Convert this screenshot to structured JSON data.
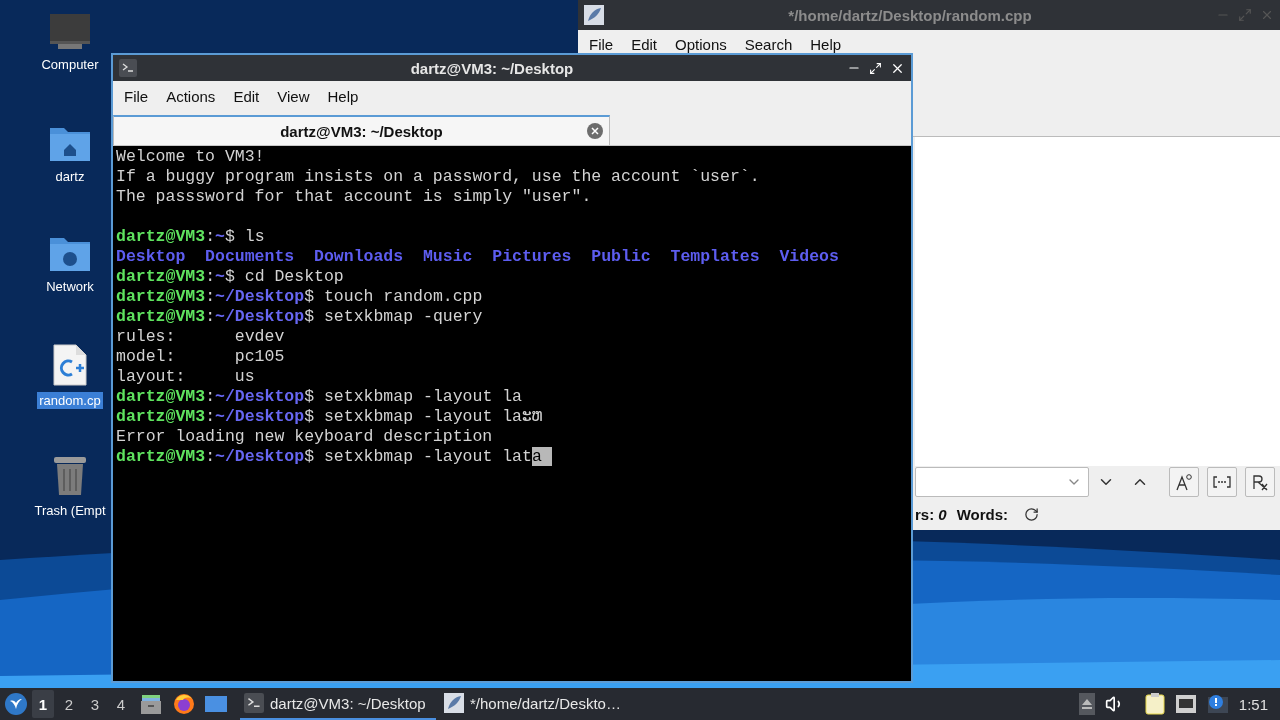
{
  "desktop_icons": [
    {
      "label": "Computer",
      "kind": "computer",
      "selected": false
    },
    {
      "label": "dartz",
      "kind": "home-folder",
      "selected": false
    },
    {
      "label": "Network",
      "kind": "network-folder",
      "selected": false
    },
    {
      "label": "random.cp",
      "kind": "cpp-file",
      "selected": true
    },
    {
      "label": "Trash (Empt",
      "kind": "trash",
      "selected": false
    }
  ],
  "editor_window": {
    "title": "*/home/dartz/Desktop/random.cpp",
    "active": false,
    "menu": [
      "File",
      "Edit",
      "Options",
      "Search",
      "Help"
    ],
    "status": "rs: *0*",
    "words_label": "Words:"
  },
  "terminal_window": {
    "title": "dartz@VM3: ~/Desktop",
    "active": true,
    "menu": [
      "File",
      "Actions",
      "Edit",
      "View",
      "Help"
    ],
    "tab": {
      "label": "dartz@VM3: ~/Desktop",
      "selected": true
    },
    "lines": [
      {
        "kind": "text",
        "text": "Welcome to VM3!"
      },
      {
        "kind": "text",
        "text": "If a buggy program insists on a password, use the account `user`."
      },
      {
        "kind": "text",
        "text": "The passsword for that account is simply \"user\"."
      },
      {
        "kind": "blank"
      },
      {
        "kind": "prompt",
        "user": "dartz@VM3",
        "colon": ":",
        "path": "~",
        "command": "$ ls"
      },
      {
        "kind": "listing",
        "items": [
          "Desktop",
          "Documents",
          "Downloads",
          "Music",
          "Pictures",
          "Public",
          "Templates",
          "Videos"
        ]
      },
      {
        "kind": "prompt",
        "user": "dartz@VM3",
        "colon": ":",
        "path": "~",
        "command": "$ cd Desktop"
      },
      {
        "kind": "prompt",
        "user": "dartz@VM3",
        "colon": ":",
        "path": "~/Desktop",
        "command": "$ touch random.cpp"
      },
      {
        "kind": "prompt",
        "user": "dartz@VM3",
        "colon": ":",
        "path": "~/Desktop",
        "command": "$ setxkbmap -query"
      },
      {
        "kind": "text",
        "text": "rules:      evdev"
      },
      {
        "kind": "text",
        "text": "model:      pc105"
      },
      {
        "kind": "text",
        "text": "layout:     us"
      },
      {
        "kind": "prompt",
        "user": "dartz@VM3",
        "colon": ":",
        "path": "~/Desktop",
        "command": "$ setxkbmap -layout la"
      },
      {
        "kind": "prompt",
        "user": "dartz@VM3",
        "colon": ":",
        "path": "~/Desktop",
        "command": "$ setxkbmap -layout laະຫ"
      },
      {
        "kind": "text",
        "text": "Error loading new keyboard description"
      },
      {
        "kind": "prompt",
        "user": "dartz@VM3",
        "colon": ":",
        "path": "~/Desktop",
        "command": "$ setxkbmap -layout lat",
        "cursor": "a"
      }
    ]
  },
  "taskbar": {
    "workspaces": [
      {
        "label": "1",
        "selected": true
      },
      {
        "label": "2",
        "selected": false
      },
      {
        "label": "3",
        "selected": false
      },
      {
        "label": "4",
        "selected": false
      }
    ],
    "tasks": [
      {
        "label": "dartz@VM3: ~/Desktop",
        "kind": "terminal",
        "selected": true
      },
      {
        "label": "*/home/dartz/Deskto…",
        "kind": "editor",
        "selected": false
      }
    ],
    "clock": "1:51"
  }
}
